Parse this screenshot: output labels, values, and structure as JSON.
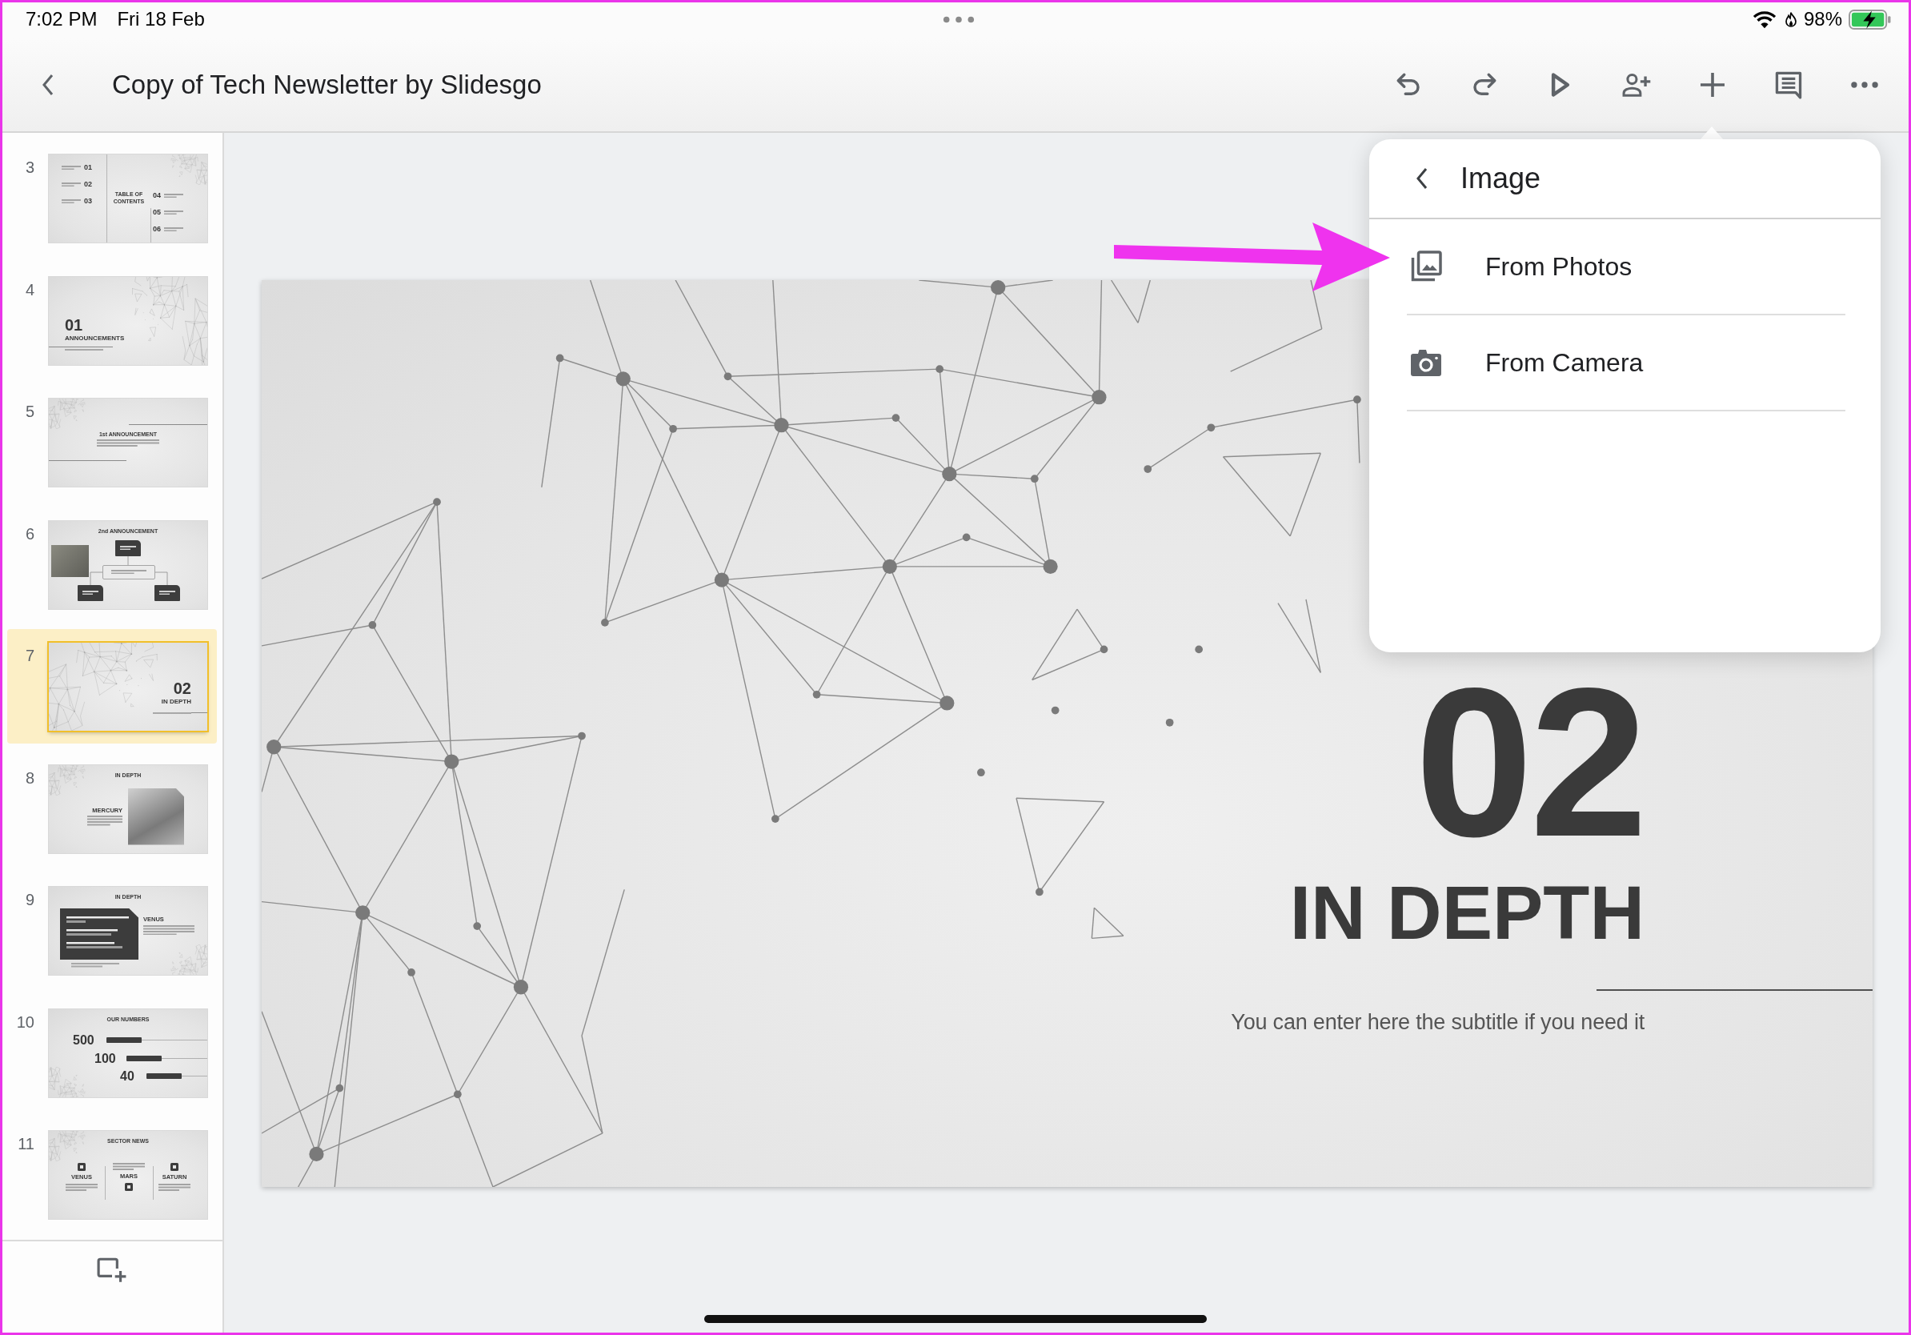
{
  "status_bar": {
    "time": "7:02 PM",
    "date": "Fri 18 Feb",
    "battery": "98%"
  },
  "toolbar": {
    "title": "Copy of Tech Newsletter by Slidesgo"
  },
  "sidebar": {
    "slides": [
      {
        "number": "3",
        "selected": false,
        "kind": "toc",
        "title": "TABLE OF CONTENTS",
        "items": [
          "01",
          "02",
          "03",
          "04",
          "05",
          "06"
        ]
      },
      {
        "number": "4",
        "selected": false,
        "kind": "section",
        "right_aligned": false,
        "heading": "01",
        "title": "ANNOUNCEMENTS"
      },
      {
        "number": "5",
        "selected": false,
        "kind": "text",
        "title": "1st ANNOUNCEMENT"
      },
      {
        "number": "6",
        "selected": false,
        "kind": "diagram",
        "title": "2nd ANNOUNCEMENT"
      },
      {
        "number": "7",
        "selected": true,
        "kind": "section",
        "right_aligned": true,
        "heading": "02",
        "title": "IN DEPTH"
      },
      {
        "number": "8",
        "selected": false,
        "kind": "photo",
        "title": "IN DEPTH",
        "label": "MERCURY"
      },
      {
        "number": "9",
        "selected": false,
        "kind": "chart",
        "title": "IN DEPTH",
        "label": "VENUS"
      },
      {
        "number": "10",
        "selected": false,
        "kind": "numbers",
        "title": "OUR NUMBERS",
        "items": [
          "500",
          "100",
          "40"
        ]
      },
      {
        "number": "11",
        "selected": false,
        "kind": "columns",
        "title": "SECTOR NEWS",
        "items": [
          "VENUS",
          "MARS",
          "SATURN"
        ]
      }
    ]
  },
  "slide": {
    "number": "02",
    "title": "IN DEPTH",
    "subtitle": "You can enter here the subtitle if you need it"
  },
  "menu": {
    "title": "Image",
    "items": [
      {
        "kind": "photos",
        "label": "From Photos"
      },
      {
        "kind": "camera",
        "label": "From Camera"
      }
    ]
  }
}
